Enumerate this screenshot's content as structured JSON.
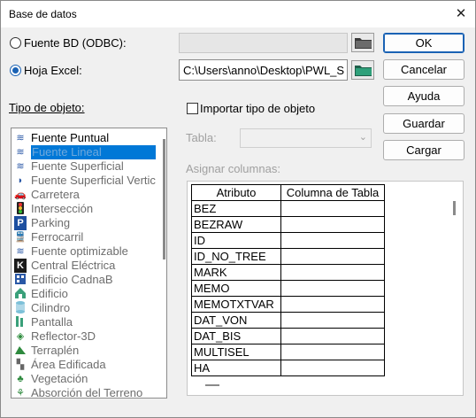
{
  "window": {
    "title": "Base de datos",
    "close_icon": "close-icon"
  },
  "source": {
    "bd_label": "Fuente BD (ODBC):",
    "bd_path": "",
    "excel_label": "Hoja Excel:",
    "excel_path": "C:\\Users\\anno\\Desktop\\PWL_S",
    "selected": "excel"
  },
  "buttons": {
    "ok": "OK",
    "cancel": "Cancelar",
    "help": "Ayuda",
    "save": "Guardar",
    "load": "Cargar"
  },
  "object_type": {
    "label": "Tipo de objeto:",
    "items": [
      {
        "label": "Fuente Puntual",
        "icon": "point-source-icon",
        "enabled": true
      },
      {
        "label": "Fuente Lineal",
        "icon": "line-source-icon",
        "enabled": true,
        "selected": true
      },
      {
        "label": "Fuente Superficial",
        "icon": "area-source-icon",
        "enabled": false
      },
      {
        "label": "Fuente Superficial Vertic",
        "icon": "vertical-area-source-icon",
        "enabled": false
      },
      {
        "label": "Carretera",
        "icon": "road-icon",
        "enabled": false
      },
      {
        "label": "Intersección",
        "icon": "traffic-light-icon",
        "enabled": false
      },
      {
        "label": "Parking",
        "icon": "parking-icon",
        "enabled": false
      },
      {
        "label": "Ferrocarril",
        "icon": "railway-icon",
        "enabled": false
      },
      {
        "label": "Fuente optimizable",
        "icon": "optimizable-source-icon",
        "enabled": false
      },
      {
        "label": "Central Eléctrica",
        "icon": "power-plant-icon",
        "enabled": false
      },
      {
        "label": "Edificio CadnaB",
        "icon": "building-cadnab-icon",
        "enabled": false
      },
      {
        "label": "Edificio",
        "icon": "building-icon",
        "enabled": false
      },
      {
        "label": "Cilindro",
        "icon": "cylinder-icon",
        "enabled": false
      },
      {
        "label": "Pantalla",
        "icon": "barrier-icon",
        "enabled": false
      },
      {
        "label": "Reflector-3D",
        "icon": "reflector-icon",
        "enabled": false
      },
      {
        "label": "Terraplén",
        "icon": "embankment-icon",
        "enabled": false
      },
      {
        "label": "Área Edificada",
        "icon": "built-area-icon",
        "enabled": false
      },
      {
        "label": "Vegetación",
        "icon": "vegetation-icon",
        "enabled": false
      },
      {
        "label": "Absorción del Terreno",
        "icon": "ground-absorption-icon",
        "enabled": false
      }
    ]
  },
  "import": {
    "checkbox_label": "Importar tipo de objeto",
    "checked": false,
    "table_label": "Tabla:",
    "table_value": "",
    "assign_label": "Asignar columnas:"
  },
  "columns_table": {
    "headers": [
      "Atributo",
      "Columna de Tabla"
    ],
    "rows": [
      [
        "BEZ",
        ""
      ],
      [
        "BEZRAW",
        ""
      ],
      [
        "ID",
        ""
      ],
      [
        "ID_NO_TREE",
        ""
      ],
      [
        "MARK",
        ""
      ],
      [
        "MEMO",
        ""
      ],
      [
        "MEMOTXTVAR",
        ""
      ],
      [
        "DAT_VON",
        ""
      ],
      [
        "DAT_BIS",
        ""
      ],
      [
        "MULTISEL",
        ""
      ],
      [
        "HA",
        ""
      ]
    ]
  },
  "colors": {
    "accent": "#1a62b4",
    "selection": "#0078d7",
    "disabled_text": "#6d6d6d"
  }
}
